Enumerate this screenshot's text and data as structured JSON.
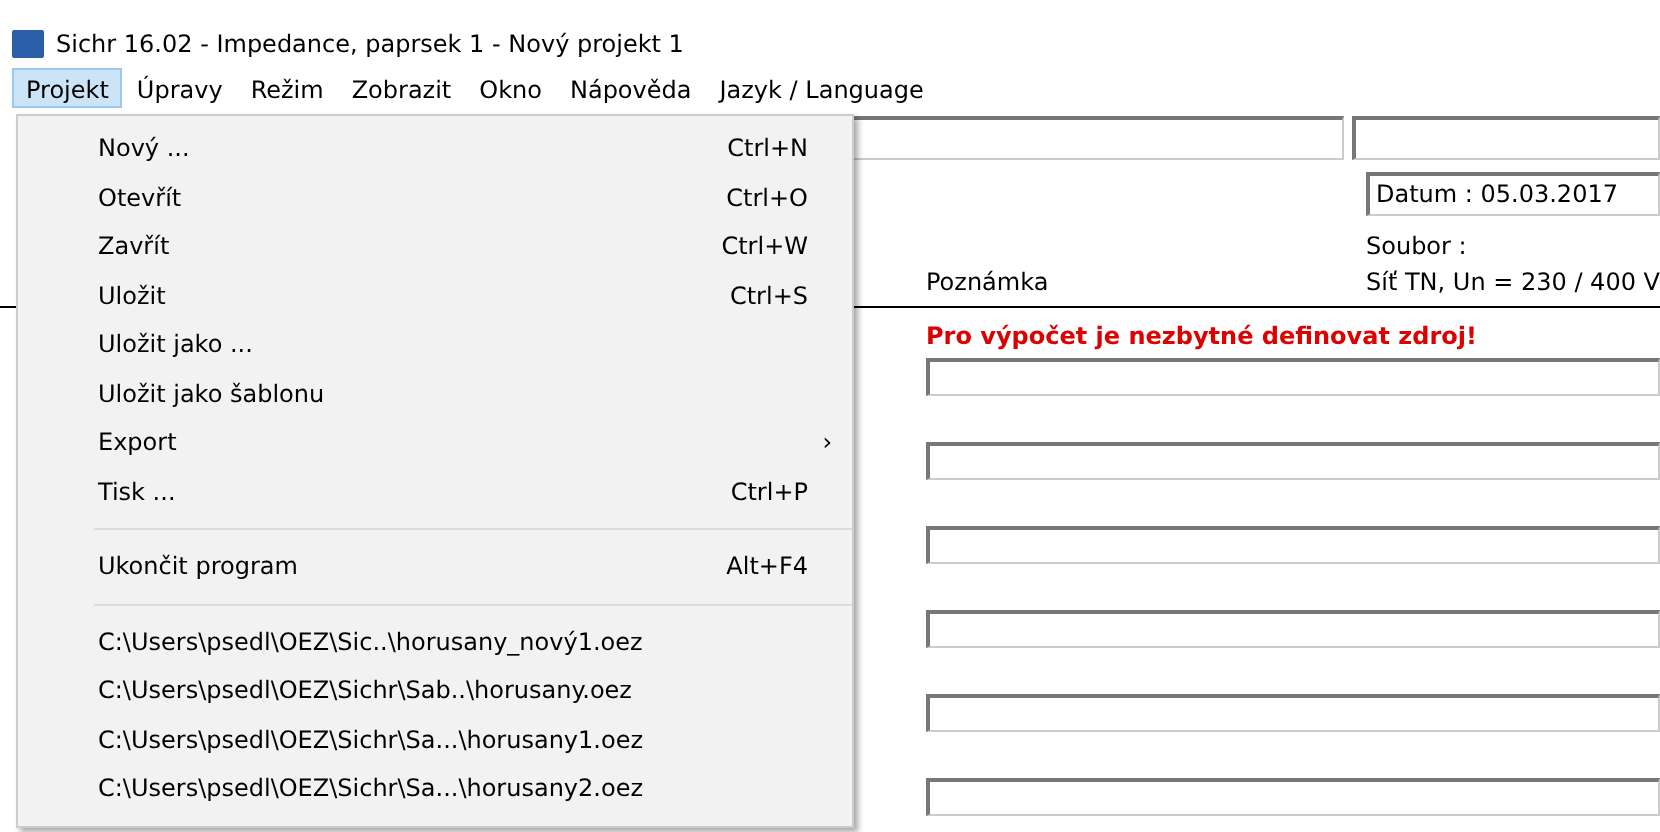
{
  "window": {
    "title": "Sichr 16.02 - Impedance, paprsek 1 - Nový projekt 1"
  },
  "menubar": [
    {
      "label": "Projekt",
      "selected": true
    },
    {
      "label": "Úpravy",
      "selected": false
    },
    {
      "label": "Režim",
      "selected": false
    },
    {
      "label": "Zobrazit",
      "selected": false
    },
    {
      "label": "Okno",
      "selected": false
    },
    {
      "label": "Nápověda",
      "selected": false
    },
    {
      "label": "Jazyk / Language",
      "selected": false
    }
  ],
  "dropdown": [
    {
      "kind": "item",
      "label": "Nový ...",
      "shortcut": "Ctrl+N"
    },
    {
      "kind": "item",
      "label": "Otevřít",
      "shortcut": "Ctrl+O"
    },
    {
      "kind": "item",
      "label": "Zavřít",
      "shortcut": "Ctrl+W"
    },
    {
      "kind": "item",
      "label": "Uložit",
      "shortcut": "Ctrl+S"
    },
    {
      "kind": "item",
      "label": "Uložit jako ..."
    },
    {
      "kind": "item",
      "label": "Uložit jako šablonu"
    },
    {
      "kind": "submenu",
      "label": "Export",
      "arrow": "›"
    },
    {
      "kind": "item",
      "label": "Tisk ...",
      "shortcut": "Ctrl+P"
    },
    {
      "kind": "separator"
    },
    {
      "kind": "item",
      "label": "Ukončit program",
      "shortcut": "Alt+F4"
    },
    {
      "kind": "separator"
    },
    {
      "kind": "item",
      "label": "C:\\Users\\psedl\\OEZ\\Sic..\\horusany_nový1.oez"
    },
    {
      "kind": "item",
      "label": "C:\\Users\\psedl\\OEZ\\Sichr\\Sab..\\horusany.oez"
    },
    {
      "kind": "item",
      "label": "C:\\Users\\psedl\\OEZ\\Sichr\\Sa...\\horusany1.oez"
    },
    {
      "kind": "item",
      "label": "C:\\Users\\psedl\\OEZ\\Sichr\\Sa...\\horusany2.oez"
    }
  ],
  "document": {
    "date": "Datum : 05.03.2017",
    "file_label": "Soubor :",
    "note_label": "Poznámka",
    "network": "Síť TN, Un = 230 / 400 V",
    "warning": "Pro výpočet je nezbytné definovat zdroj!",
    "entry_fields": [
      {
        "kind": "text"
      },
      {
        "kind": "text"
      },
      {
        "kind": "text"
      },
      {
        "kind": "text"
      },
      {
        "kind": "text"
      },
      {
        "kind": "text"
      }
    ]
  }
}
